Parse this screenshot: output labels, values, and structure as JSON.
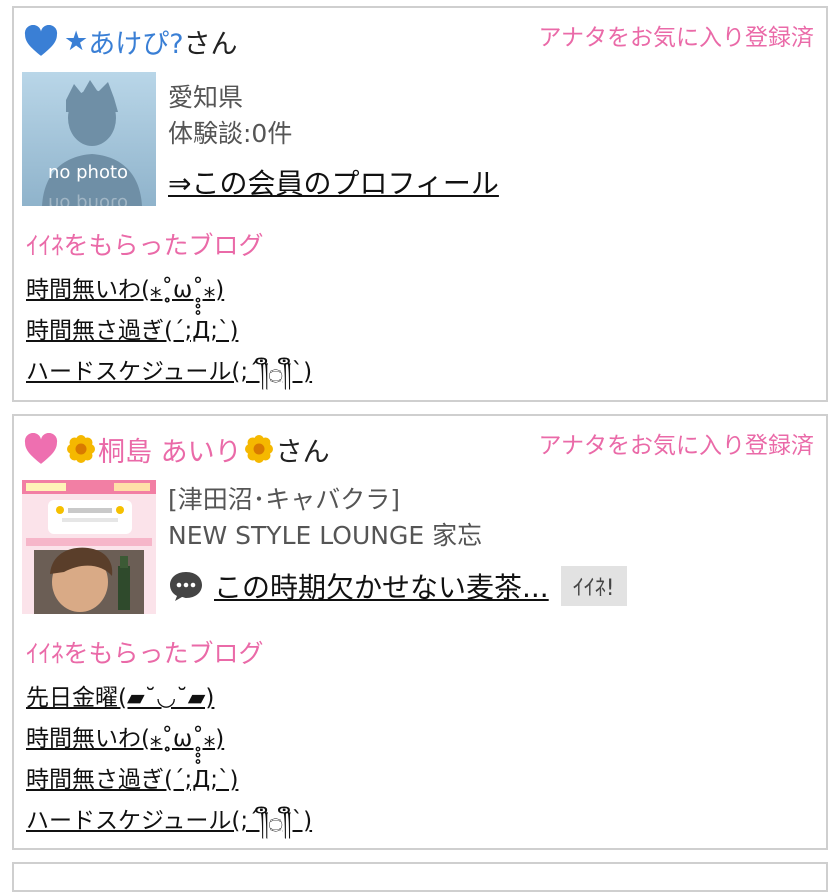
{
  "cards": [
    {
      "star": "★",
      "name": "あけぴ?",
      "suffix": "さん",
      "favorite": "アナタをお気に入り登録済",
      "photo_label": "no photo",
      "line1": "愛知県",
      "line2": "体験談:0件",
      "profile_link": "⇒この会員のプロフィール",
      "section_title": "ｲｲﾈをもらったブログ",
      "blogs": [
        "時間無いわ(⁎˚̥̥̥ω˚̥̥̥⁎)",
        "時間無さ過ぎ(´;Д;`)",
        "ハードスケジュール(;´༎ຶ۝༎ຶ`)"
      ]
    },
    {
      "name": "桐島 あいり",
      "suffix": "さん",
      "favorite": "アナタをお気に入り登録済",
      "line1": "[津田沼･キャバクラ]",
      "line2": "NEW STYLE LOUNGE 家忘",
      "latest_blog": "この時期欠かせない麦茶...",
      "iine_button": "ｲｲﾈ!",
      "section_title": "ｲｲﾈをもらったブログ",
      "blogs": [
        "先日金曜(▰˘◡˘▰)",
        "時間無いわ(⁎˚̥̥̥ω˚̥̥̥⁎)",
        "時間無さ過ぎ(´;Д;`)",
        "ハードスケジュール(;´༎ຶ۝༎ຶ`)"
      ]
    }
  ],
  "colors": {
    "pink": "#ea6aa8",
    "blue": "#3a7fd5",
    "border": "#cfcfcf"
  }
}
